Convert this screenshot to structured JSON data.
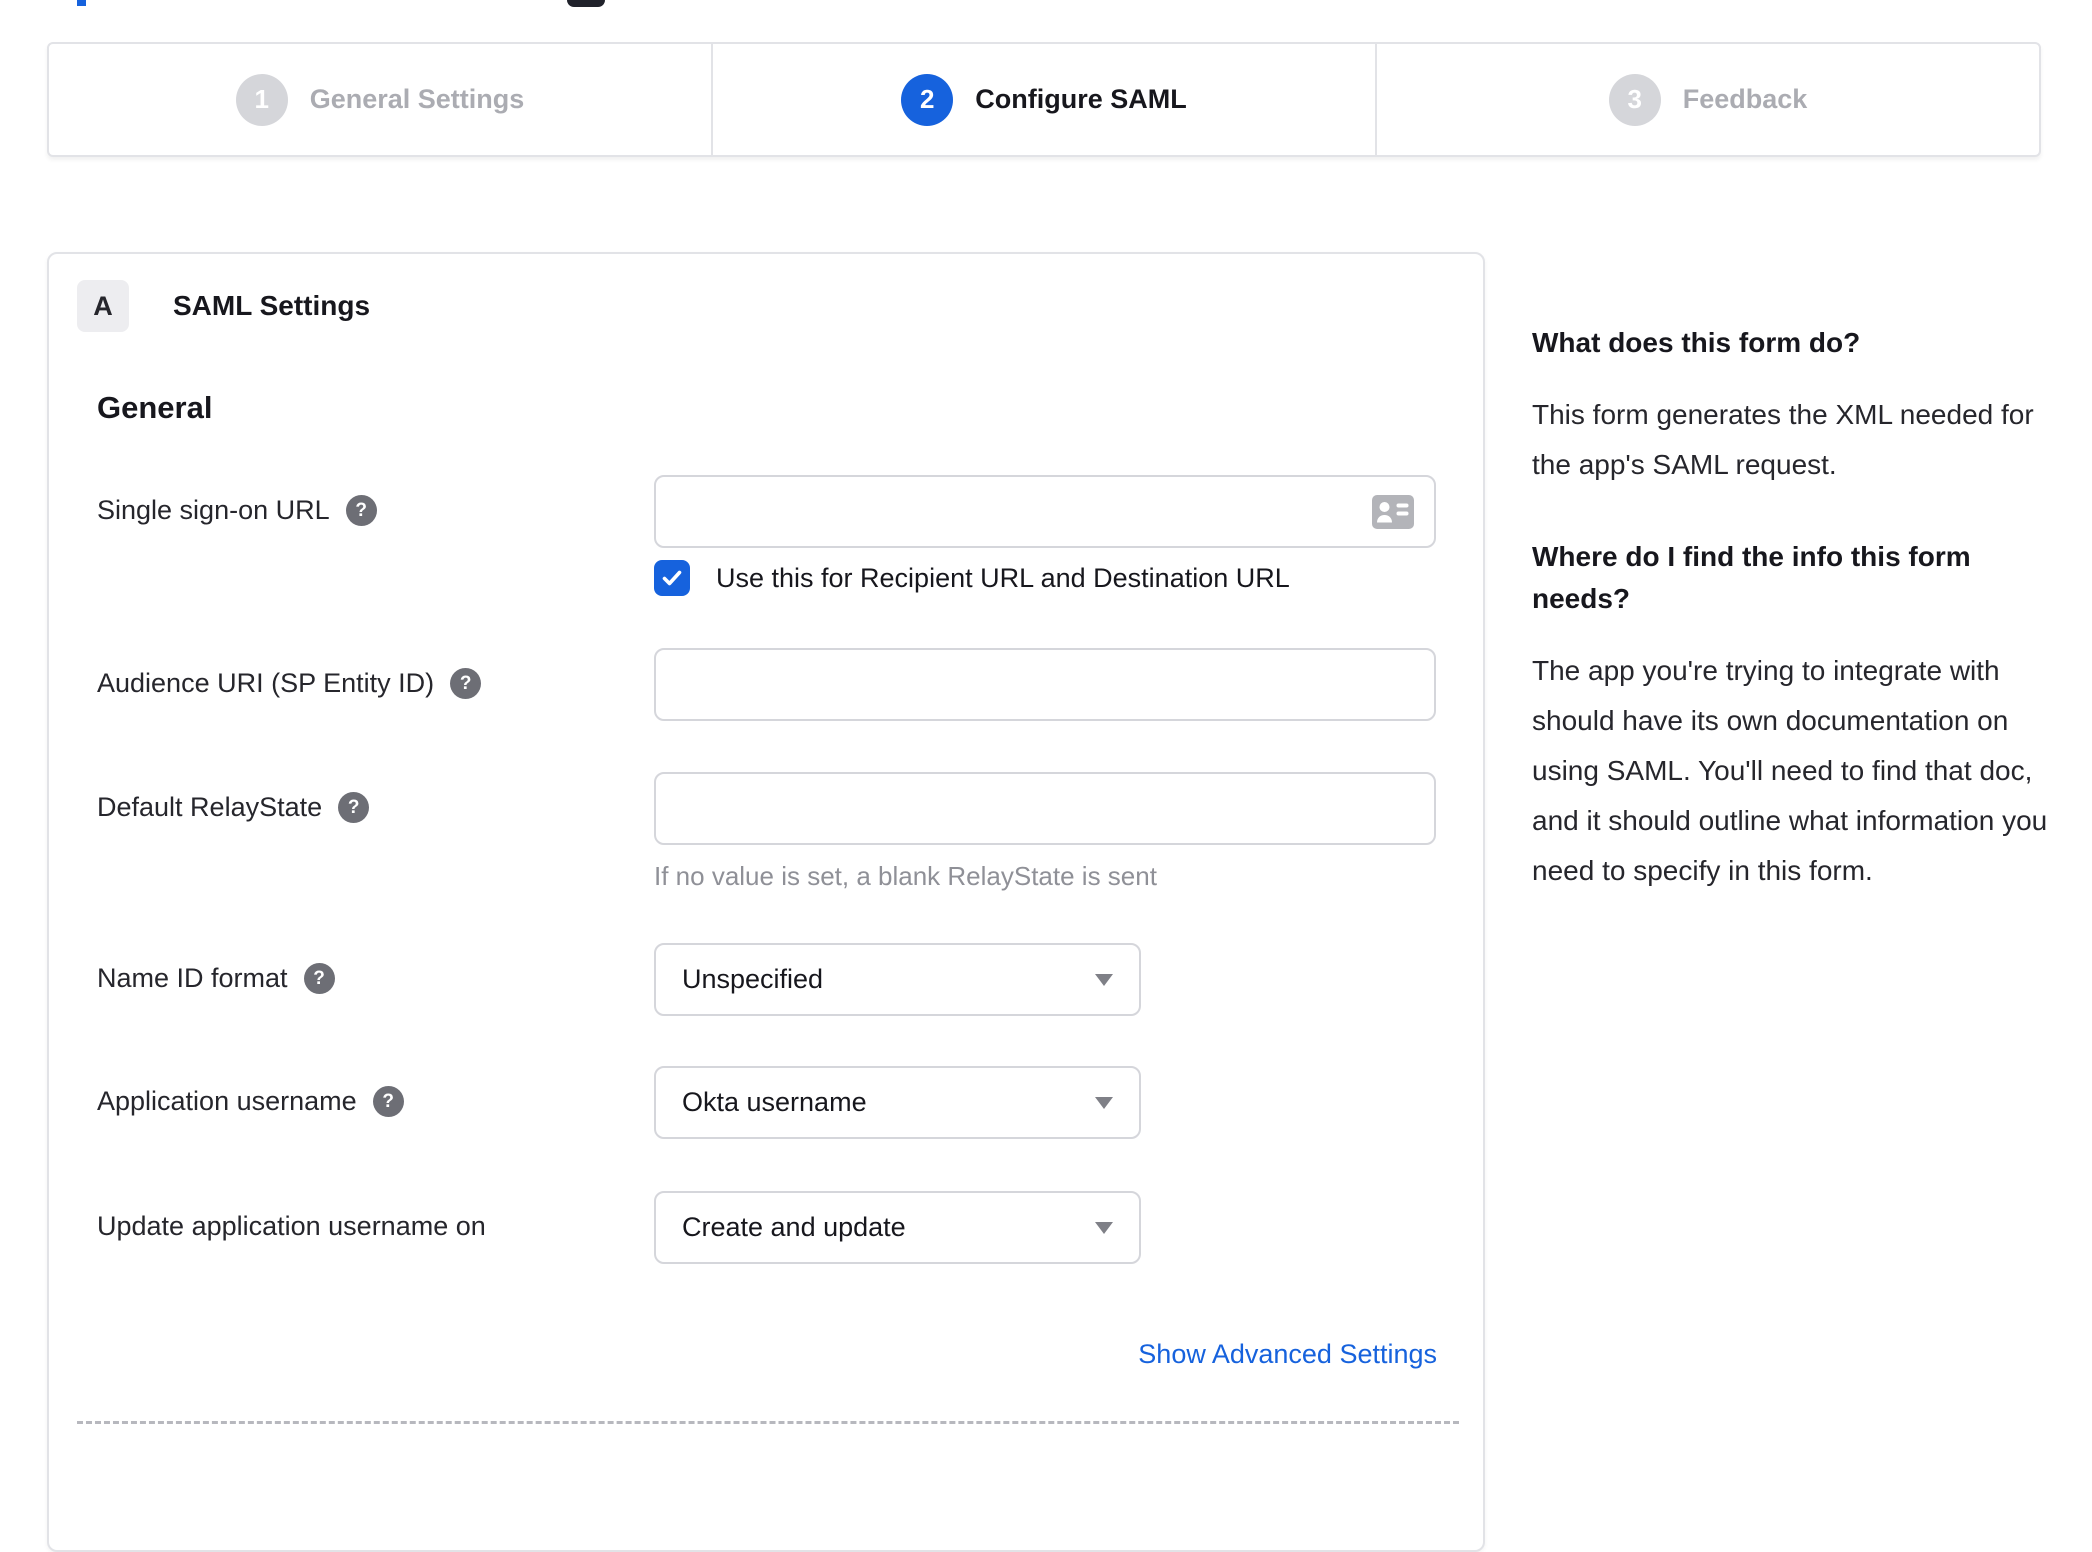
{
  "colors": {
    "accent_blue": "#1662dd",
    "inactive_gray": "#abacb2",
    "border_gray": "#e2e3e7",
    "input_border": "#d5d6db",
    "helper_gray": "#8f9097",
    "text_dark": "#17171d"
  },
  "icons": {
    "help_glyph": "?",
    "sso_input_icon": "contact-card",
    "dropdown_caret": "triangle-down",
    "checkbox_check": "checkmark"
  },
  "stepper": {
    "steps": [
      {
        "number": "1",
        "label": "General Settings",
        "state": "inactive"
      },
      {
        "number": "2",
        "label": "Configure SAML",
        "state": "active"
      },
      {
        "number": "3",
        "label": "Feedback",
        "state": "inactive"
      }
    ]
  },
  "form": {
    "section_badge": "A",
    "section_title": "SAML Settings",
    "group_title": "General",
    "fields": {
      "sso_url": {
        "label": "Single sign-on URL",
        "value": "",
        "has_help": true
      },
      "sso_checkbox": {
        "label": "Use this for Recipient URL and Destination URL",
        "checked": true
      },
      "audience_uri": {
        "label": "Audience URI (SP Entity ID)",
        "value": "",
        "has_help": true
      },
      "relay_state": {
        "label": "Default RelayState",
        "value": "",
        "has_help": true,
        "help_text": "If no value is set, a blank RelayState is sent"
      },
      "name_id_format": {
        "label": "Name ID format",
        "value": "Unspecified",
        "has_help": true
      },
      "app_username": {
        "label": "Application username",
        "value": "Okta username",
        "has_help": true
      },
      "update_app_username": {
        "label": "Update application username on",
        "value": "Create and update",
        "has_help": false
      }
    },
    "advanced_link": "Show Advanced Settings"
  },
  "help_panel": {
    "sections": [
      {
        "title": "What does this form do?",
        "body": "This form generates the XML needed for the app's SAML request."
      },
      {
        "title": "Where do I find the info this form needs?",
        "body": "The app you're trying to integrate with should have its own documentation on using SAML. You'll need to find that doc, and it should outline what information you need to specify in this form."
      }
    ]
  }
}
